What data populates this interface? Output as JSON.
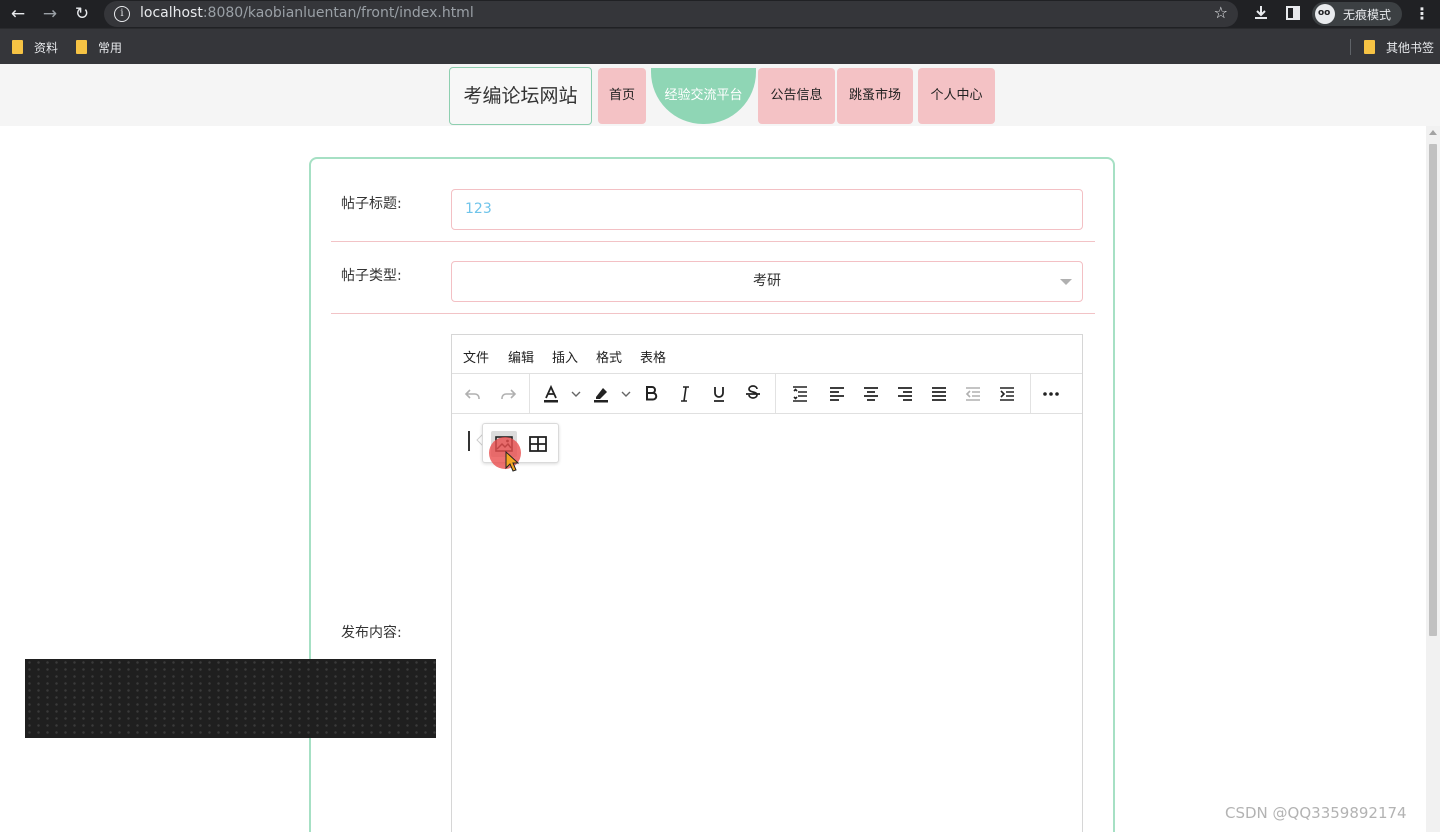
{
  "browser": {
    "url_host": "localhost",
    "url_rest": ":8080/kaobianluentan/front/index.html",
    "incognito_label": "无痕模式",
    "bookmarks": [
      "资料",
      "常用"
    ],
    "other_bookmarks": "其他书签"
  },
  "nav": {
    "logo": "考编论坛网站",
    "items": [
      {
        "label": "首页",
        "active": false
      },
      {
        "label": "经验交流平台",
        "active": true
      },
      {
        "label": "公告信息",
        "active": false
      },
      {
        "label": "跳蚤市场",
        "active": false
      },
      {
        "label": "个人中心",
        "active": false
      }
    ]
  },
  "form": {
    "title_label": "帖子标题:",
    "title_value": "123",
    "type_label": "帖子类型:",
    "type_value": "考研",
    "content_label": "发布内容:"
  },
  "editor": {
    "menus": [
      "文件",
      "编辑",
      "插入",
      "格式",
      "表格"
    ],
    "toolbar_icons": [
      "undo-icon",
      "redo-icon",
      "text-color-icon",
      "highlight-icon",
      "bold-icon",
      "italic-icon",
      "underline-icon",
      "strikethrough-icon",
      "line-height-icon",
      "align-left-icon",
      "align-center-icon",
      "align-right-icon",
      "justify-icon",
      "outdent-icon",
      "indent-icon",
      "more-icon"
    ],
    "quick_insert_icons": [
      "image-icon",
      "table-icon"
    ]
  },
  "watermark": "CSDN @QQ3359892174",
  "colors": {
    "nav_pink": "#f4c2c5",
    "nav_active_green": "#8fd6b5",
    "card_border": "#a6e0c4",
    "title_value_blue": "#6fc4ea"
  }
}
